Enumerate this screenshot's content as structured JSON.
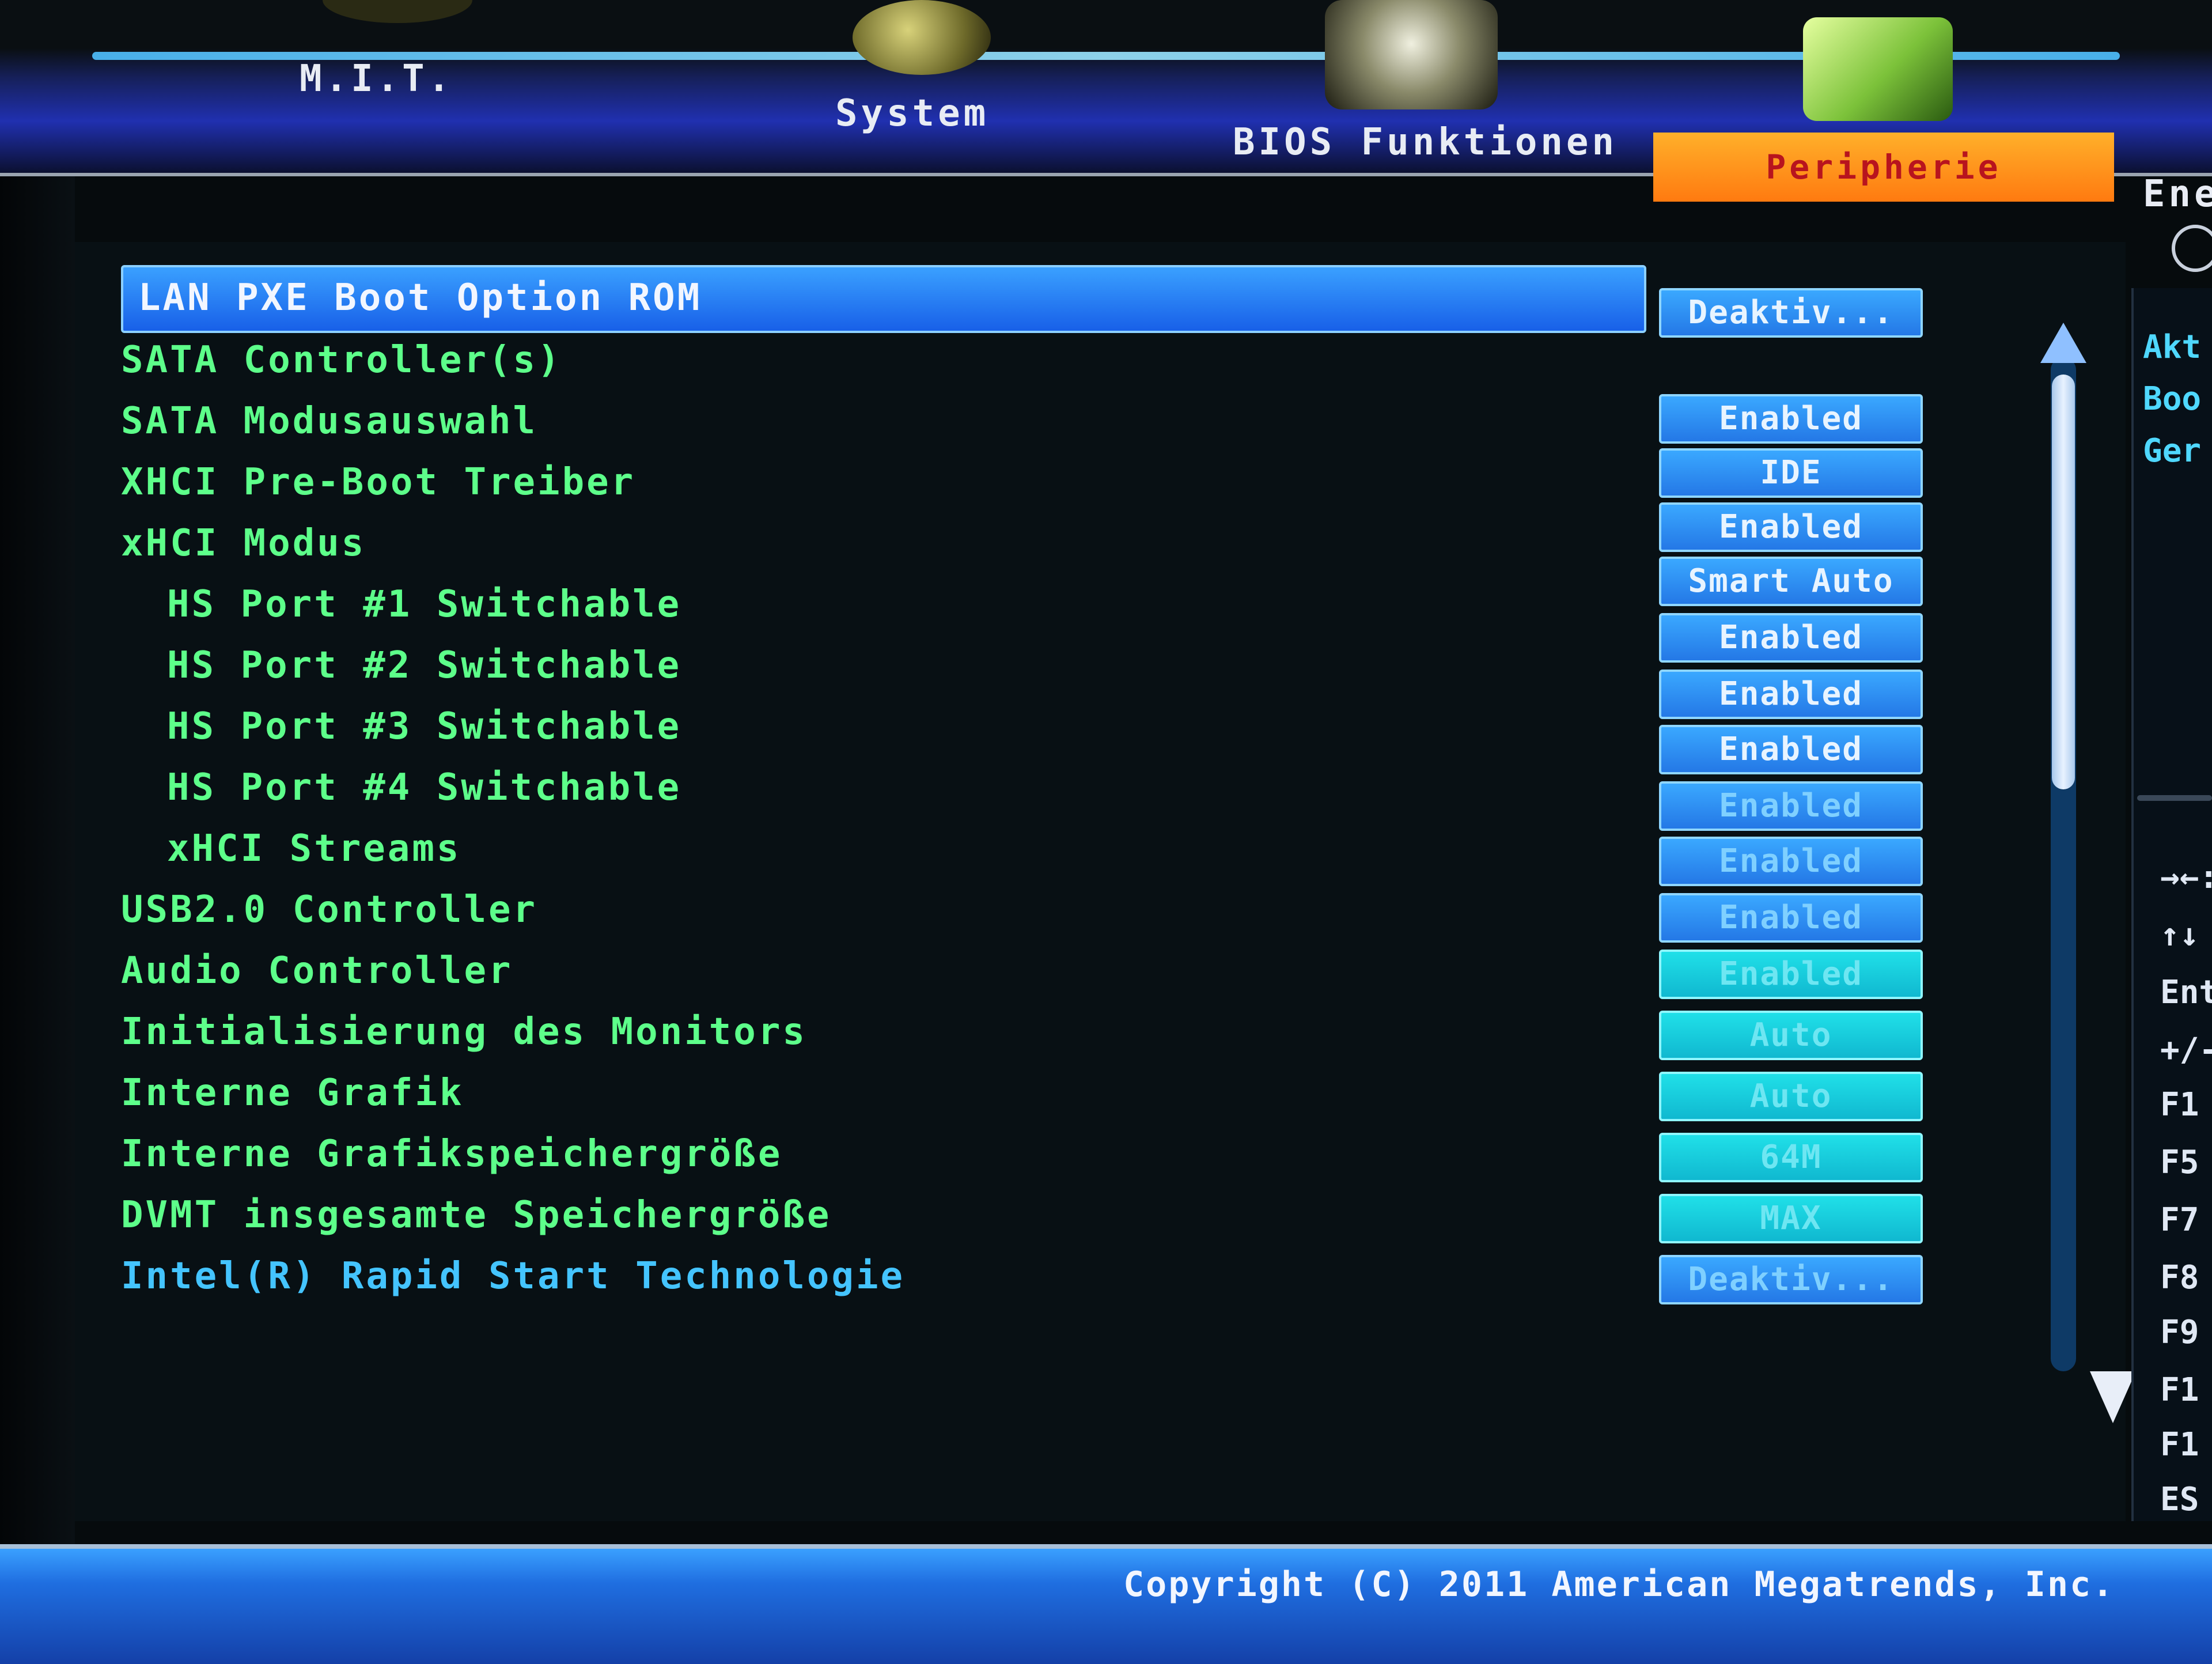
{
  "tabs": [
    {
      "label": "M.I.T."
    },
    {
      "label": "System"
    },
    {
      "label": "BIOS Funktionen"
    },
    {
      "label": "Peripherie",
      "active": true
    },
    {
      "label": "Ene"
    }
  ],
  "settings": [
    {
      "label": "LAN PXE Boot Option ROM",
      "value": "Deaktiv..."
    },
    {
      "label": "SATA Controller(s)",
      "value": "Enabled"
    },
    {
      "label": "SATA Modusauswahl",
      "value": "IDE"
    },
    {
      "label": "XHCI Pre-Boot Treiber",
      "value": "Enabled"
    },
    {
      "label": "xHCI Modus",
      "value": "Smart Auto"
    },
    {
      "label": "HS Port #1 Switchable",
      "value": "Enabled"
    },
    {
      "label": "HS Port #2 Switchable",
      "value": "Enabled"
    },
    {
      "label": "HS Port #3 Switchable",
      "value": "Enabled"
    },
    {
      "label": "HS Port #4 Switchable",
      "value": "Enabled"
    },
    {
      "label": "xHCI Streams",
      "value": "Enabled"
    },
    {
      "label": "USB2.0 Controller",
      "value": "Enabled"
    },
    {
      "label": "Audio Controller",
      "value": "Enabled"
    },
    {
      "label": "Initialisierung des Monitors",
      "value": "Auto"
    },
    {
      "label": "Interne Grafik",
      "value": "Auto"
    },
    {
      "label": "Interne Grafikspeichergröße",
      "value": "64M"
    },
    {
      "label": "DVMT insgesamte Speichergröße",
      "value": "MAX"
    },
    {
      "label": "Intel(R) Rapid Start Technologie",
      "value": "Deaktiv..."
    }
  ],
  "help": {
    "lines": [
      "Akt",
      "Boo",
      "Ger"
    ],
    "keys": [
      "→←:",
      "↑↓",
      "Ent",
      "+/-",
      "F1",
      "F5",
      "F7",
      "F8",
      "F9",
      "F1",
      "F1",
      "ES"
    ]
  },
  "footer": {
    "copyright": "Copyright (C) 2011 American Megatrends, Inc."
  },
  "colors": {
    "label_green": "#5dff8a",
    "highlight_blue": "#1860e8",
    "active_tab_orange": "#ff7a10",
    "link_blue": "#44c4ff"
  }
}
